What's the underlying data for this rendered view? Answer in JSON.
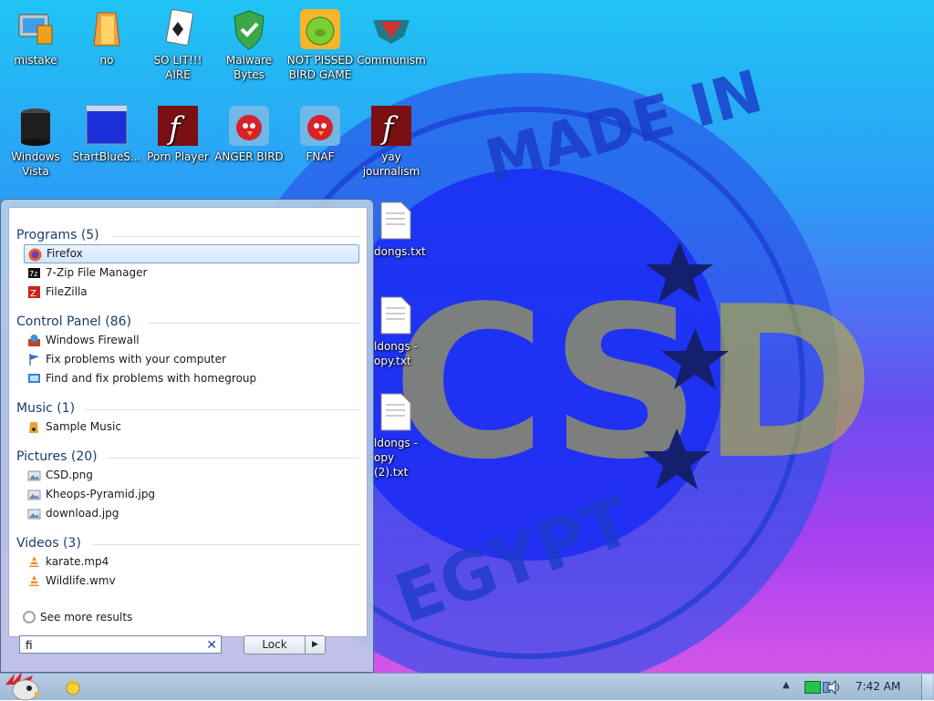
{
  "desktop_icons": [
    {
      "label": "mistake",
      "icon": "computer-icon"
    },
    {
      "label": "no",
      "icon": "folder-icon"
    },
    {
      "label": "SO LIT!!! AIRE",
      "icon": "solitaire-icon"
    },
    {
      "label": "Malware Bytes",
      "icon": "shield-check-icon"
    },
    {
      "label": "NOT PISSED BIRD GAME",
      "icon": "green-pig-icon"
    },
    {
      "label": "Communism",
      "icon": "red-emblem-icon"
    },
    {
      "label": "Windows Vista",
      "icon": "trash-bin-icon"
    },
    {
      "label": "StartBlueS...",
      "icon": "blue-window-icon"
    },
    {
      "label": "Porn Player",
      "icon": "flash-icon"
    },
    {
      "label": "ANGER BIRD",
      "icon": "angry-bird-icon"
    },
    {
      "label": "FNAF",
      "icon": "angry-bird-icon"
    },
    {
      "label": "yay journalism",
      "icon": "flash-icon"
    },
    {
      "label": "dongs.txt",
      "icon": "text-file-icon"
    },
    {
      "label": "ldongs - opy.txt",
      "icon": "text-file-icon"
    },
    {
      "label": "ldongs - opy (2).txt",
      "icon": "text-file-icon"
    }
  ],
  "wallpaper": {
    "top_text": "MADE IN",
    "center_text": "CSD",
    "bottom_text": "EGYPT"
  },
  "start_menu": {
    "groups": [
      {
        "title": "Programs (5)",
        "items": [
          {
            "label": "Firefox",
            "icon": "firefox-icon",
            "selected": true
          },
          {
            "label": "7-Zip File Manager",
            "icon": "7zip-icon"
          },
          {
            "label": "FileZilla",
            "icon": "filezilla-icon"
          }
        ]
      },
      {
        "title": "Control Panel (86)",
        "items": [
          {
            "label": "Windows Firewall",
            "icon": "firewall-icon"
          },
          {
            "label": "Fix problems with your computer",
            "icon": "flag-icon"
          },
          {
            "label": "Find and fix problems with homegroup",
            "icon": "homegroup-icon"
          }
        ]
      },
      {
        "title": "Music (1)",
        "items": [
          {
            "label": "Sample Music",
            "icon": "music-folder-icon"
          }
        ]
      },
      {
        "title": "Pictures (20)",
        "items": [
          {
            "label": "CSD.png",
            "icon": "image-file-icon"
          },
          {
            "label": "Kheops-Pyramid.jpg",
            "icon": "image-file-icon"
          },
          {
            "label": "download.jpg",
            "icon": "image-file-icon"
          }
        ]
      },
      {
        "title": "Videos (3)",
        "items": [
          {
            "label": "karate.mp4",
            "icon": "vlc-icon"
          },
          {
            "label": "Wildlife.wmv",
            "icon": "vlc-icon"
          }
        ]
      }
    ],
    "see_more": "See more results",
    "search_value": "fi",
    "search_clear": "✕",
    "lock_label": "Lock",
    "lock_arrow": "▶"
  },
  "taskbar": {
    "clock": "7:42 AM",
    "tray_arrow": "▲"
  }
}
